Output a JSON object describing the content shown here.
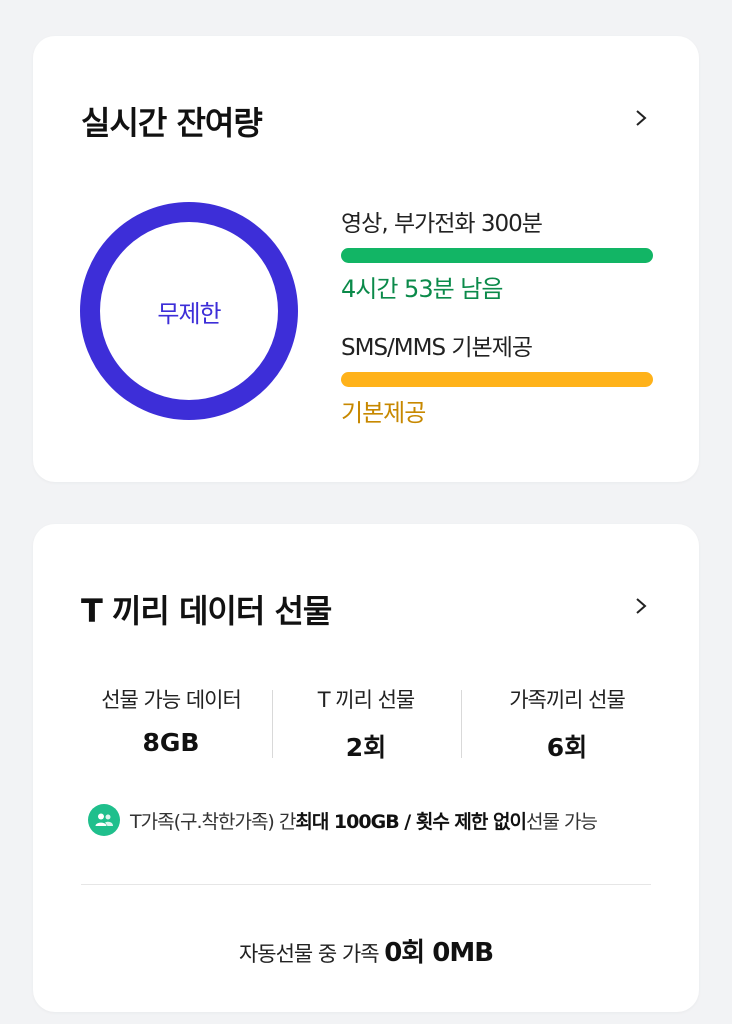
{
  "realtime": {
    "title": "실시간 잔여량",
    "ring_label": "무제한",
    "ring_color": "#3d2ed8",
    "chevron_icon": "chevron-right-icon",
    "items": [
      {
        "title": "영상, 부가전화 300분",
        "remain": "4시간 53분 남음",
        "bar_color": "#12b565",
        "text_color": "#0b8a4a",
        "fill": 1.0
      },
      {
        "title": "SMS/MMS 기본제공",
        "remain": "기본제공",
        "bar_color": "#ffb21a",
        "text_color": "#c78800",
        "fill": 1.0
      }
    ]
  },
  "gift": {
    "title": "T 끼리 데이터 선물",
    "chevron_icon": "chevron-right-icon",
    "stats": [
      {
        "label": "선물 가능 데이터",
        "value": "8GB"
      },
      {
        "label": "T 끼리 선물",
        "value": "2회"
      },
      {
        "label": "가족끼리 선물",
        "value": "6회"
      }
    ],
    "info_icon": "people-icon",
    "info_prefix": "T가족(구.착한가족) 간 ",
    "info_bold": "최대 100GB / 횟수 제한 없이",
    "info_suffix": " 선물 가능",
    "auto_prefix": "자동선물 중 가족 ",
    "auto_value": "0회 0MB",
    "accent_color": "#1fbf8c"
  }
}
